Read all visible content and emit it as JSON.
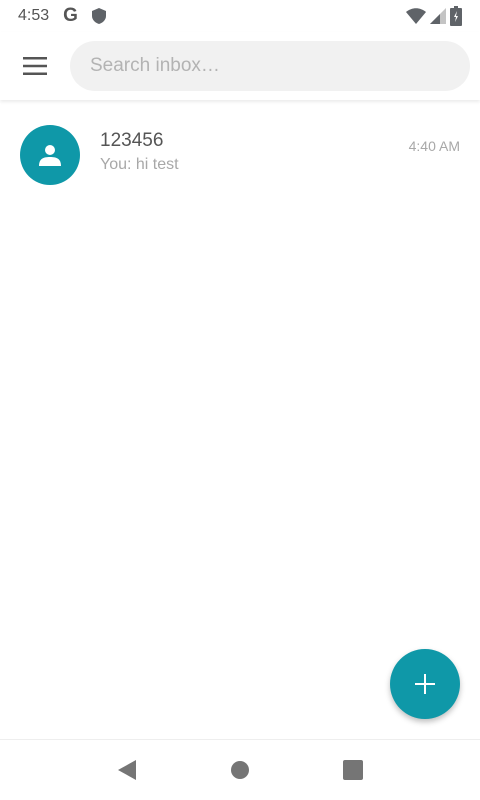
{
  "status_bar": {
    "time": "4:53",
    "g_label": "G",
    "icons": [
      "google-icon",
      "shield-icon",
      "wifi-icon",
      "cell-signal-icon",
      "battery-icon"
    ]
  },
  "toolbar": {
    "menu_icon": "menu-icon",
    "search": {
      "placeholder": "Search inbox…",
      "value": ""
    }
  },
  "conversations": [
    {
      "name": "123456",
      "snippet": "You: hi test",
      "time": "4:40 AM",
      "avatar_icon": "person-icon"
    }
  ],
  "fab": {
    "icon": "plus-icon"
  },
  "nav_bar": {
    "icons": [
      "back-icon",
      "home-icon",
      "recents-icon"
    ]
  },
  "colors": {
    "accent": "#0f98a8",
    "text_primary": "#555555",
    "text_secondary": "#a8a8a8",
    "search_bg": "#f1f1f1"
  }
}
